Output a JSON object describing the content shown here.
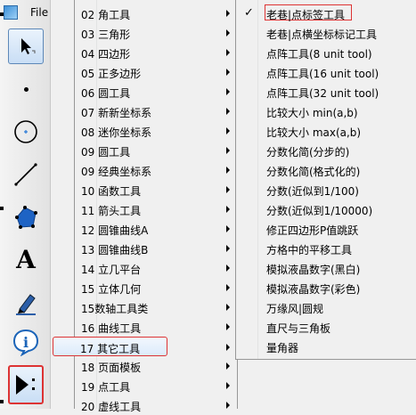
{
  "app": {
    "file_menu_label": "File"
  },
  "toolbar": {
    "tools": [
      {
        "name": "arrow-select-tool",
        "icon": "arrow-icon",
        "active": true
      },
      {
        "name": "point-tool",
        "icon": "point-icon"
      },
      {
        "name": "compass-tool",
        "icon": "circle-icon"
      },
      {
        "name": "segment-tool",
        "icon": "line-icon"
      },
      {
        "name": "polygon-tool",
        "icon": "polygon-icon"
      },
      {
        "name": "text-tool",
        "icon": "text-a-icon",
        "glyph": "A"
      },
      {
        "name": "marker-tool",
        "icon": "marker-icon"
      },
      {
        "name": "info-tool",
        "icon": "info-icon",
        "glyph": "i"
      },
      {
        "name": "custom-tool",
        "icon": "custom-tool-icon",
        "active": true
      }
    ]
  },
  "menu_left": {
    "items": [
      "02 角工具",
      "03 三角形",
      "04 四边形",
      "05 正多边形",
      "06 圆工具",
      "07 新新坐标系",
      "08 迷你坐标系",
      "09 圆工具",
      "09 经典坐标系",
      "10 函数工具",
      "11 箭头工具",
      "12 圆锥曲线A",
      "13 圆锥曲线B",
      "14 立几平台",
      "15 立体几何",
      "15数轴工具类",
      "16 曲线工具",
      "17 其它工具",
      "18 页面模板",
      "19 点工具",
      "20 虚线工具"
    ],
    "highlighted_index": 17
  },
  "menu_right": {
    "items": [
      "老巷|点标签工具",
      "老巷|点横坐标标记工具",
      "点阵工具(8 unit tool)",
      "点阵工具(16 unit tool)",
      "点阵工具(32 unit tool)",
      "比较大小 min(a,b)",
      "比较大小 max(a,b)",
      "分数化简(分步的)",
      "分数化简(格式化的)",
      "分数(近似到1/100)",
      "分数(近似到1/10000)",
      "修正四边形P值跳跃",
      "方格中的平移工具",
      "模拟液晶数字(黑白)",
      "模拟液晶数字(彩色)",
      "万缘风|圆规",
      "直尺与三角板",
      "量角器"
    ],
    "checked_index": 0,
    "check_mark": "✓"
  },
  "colors": {
    "highlight_border": "#8ab3e0",
    "annotation_red": "#dd3333"
  }
}
